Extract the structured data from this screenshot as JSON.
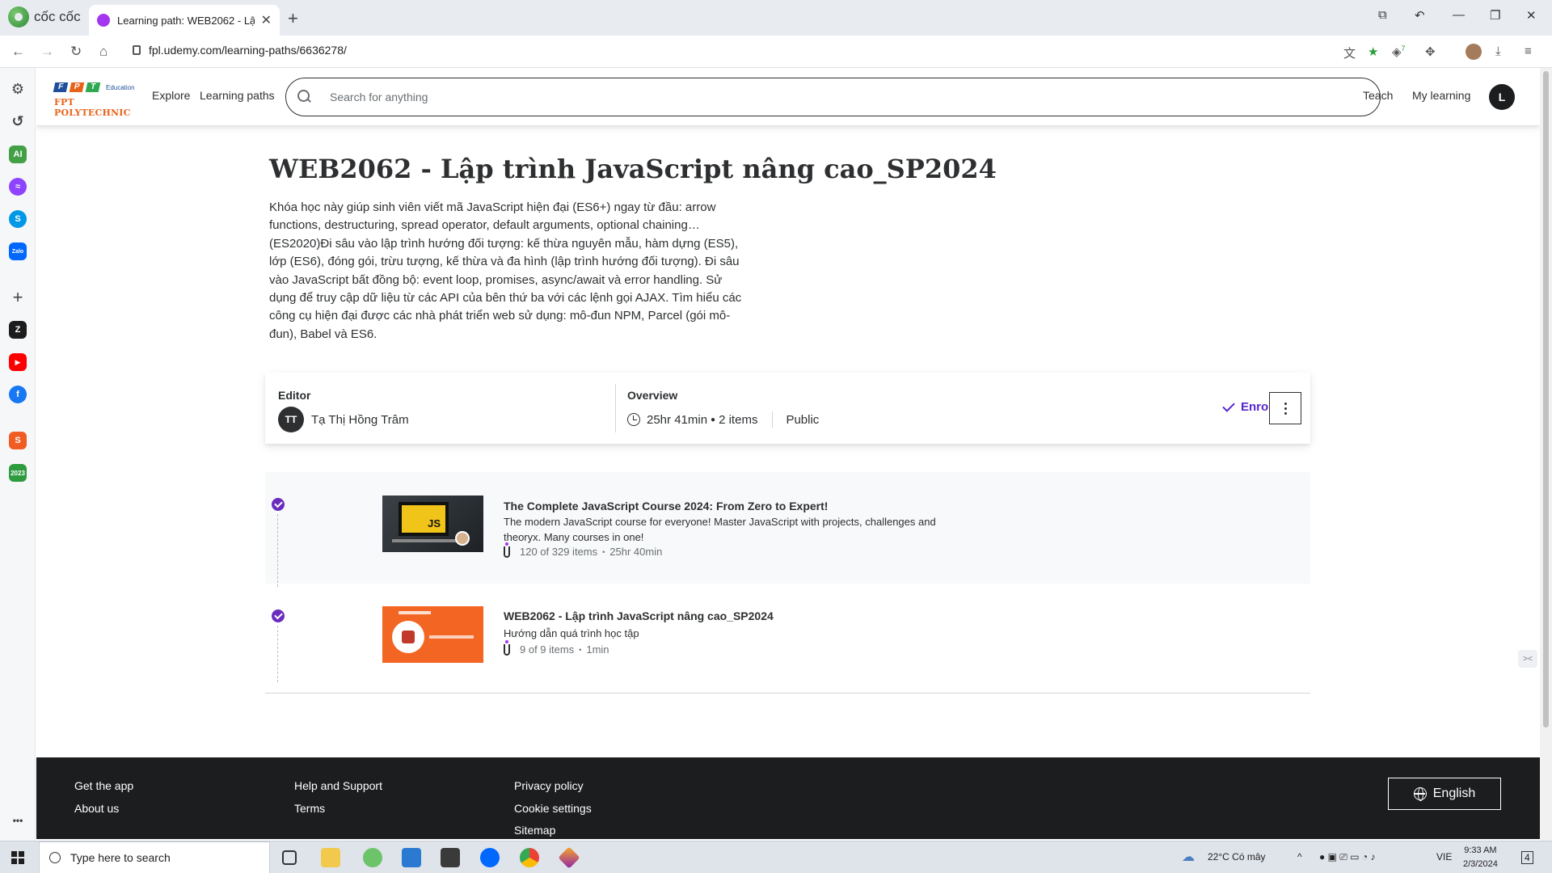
{
  "browser": {
    "brand": "cốc cốc",
    "tab_title": "Learning path: WEB2062 - Lậ",
    "url": "fpl.udemy.com/learning-paths/6636278/",
    "ext_badge": "7"
  },
  "sidebar": {
    "items": [
      {
        "name": "settings",
        "color": "#444444"
      },
      {
        "name": "history",
        "color": "#444444"
      },
      {
        "name": "ai",
        "color": "#43a047",
        "label": "AI"
      },
      {
        "name": "messenger",
        "color": "#8e44ff"
      },
      {
        "name": "skype",
        "color": "#0098e6",
        "label": "S"
      },
      {
        "name": "zalo",
        "color": "#0068ff",
        "label": "Zalo"
      },
      {
        "name": "add",
        "color": "#444444"
      },
      {
        "name": "zing",
        "color": "#1c1c1c",
        "label": "Z"
      },
      {
        "name": "youtube",
        "color": "#ff0000"
      },
      {
        "name": "facebook",
        "color": "#1877f2"
      },
      {
        "name": "shopee",
        "color": "#f05d23",
        "label": "S"
      },
      {
        "name": "calendar",
        "color": "#2e9b3f",
        "label": "2023"
      }
    ],
    "more": "•••"
  },
  "header": {
    "logo_fpt": [
      "F",
      "P",
      "T"
    ],
    "logo_education": "Education",
    "logo_poly": "FPT POLYTECHNIC",
    "explore": "Explore",
    "learning_paths": "Learning paths",
    "search_placeholder": "Search for anything",
    "teach": "Teach",
    "my_learning": "My learning",
    "avatar_initial": "L"
  },
  "learning_path": {
    "title": "WEB2062 - Lập trình JavaScript nâng cao_SP2024",
    "description": "Khóa học này giúp sinh viên viết mã JavaScript hiện đại (ES6+) ngay từ đầu: arrow functions, destructuring, spread operator, default arguments, optional chaining…(ES2020)Đi sâu vào lập trình hướng đối tượng: kế thừa nguyên mẫu, hàm dựng (ES5), lớp (ES6), đóng gói, trừu tượng, kế thừa và đa hình (lập trình hướng đối tượng). Đi sâu vào JavaScript bất đồng bộ: event loop, promises, async/await và error handling. Sử dụng để truy cập dữ liệu từ các API của bên thứ ba với các lệnh gọi AJAX. Tìm hiểu các công cụ hiện đại được các nhà phát triển web sử dụng: mô-đun NPM, Parcel (gói mô-đun), Babel và ES6.",
    "editor_label": "Editor",
    "editor_initials": "TT",
    "editor_name": "Tạ Thị Hồng Trâm",
    "overview_label": "Overview",
    "duration": "25hr 41min",
    "item_count": "2 items",
    "visibility": "Public",
    "enrolled": "Enrolled"
  },
  "courses": [
    {
      "title": "The Complete JavaScript Course 2024: From Zero to Expert!",
      "subtitle": "The modern JavaScript course for everyone! Master JavaScript with projects, challenges and theoryx. Many courses in one!",
      "progress": "120 of 329 items",
      "duration": "25hr 40min",
      "thumb_label": "JS"
    },
    {
      "title": "WEB2062 - Lập trình JavaScript nâng cao_SP2024",
      "subtitle": "Hướng dẫn quá trình học tập",
      "progress": "9 of 9 items",
      "duration": "1min"
    }
  ],
  "footer": {
    "get_app": "Get the app",
    "about": "About us",
    "help": "Help and Support",
    "terms": "Terms",
    "privacy": "Privacy policy",
    "cookie": "Cookie settings",
    "sitemap": "Sitemap",
    "language": "English"
  },
  "taskbar": {
    "search_placeholder": "Type here to search",
    "weather": "22°C  Có mây",
    "lang": "VIE",
    "time": "9:33 AM",
    "date": "2/3/2024",
    "notifications": "4"
  }
}
